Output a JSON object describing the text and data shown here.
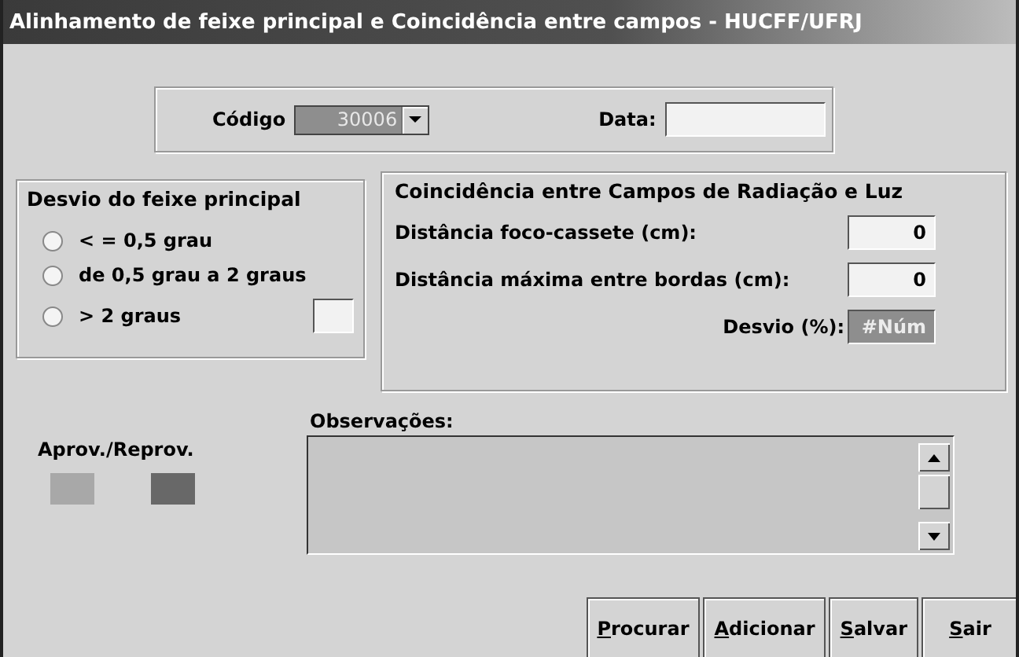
{
  "window": {
    "title": "Alinhamento de feixe principal e Coincidência entre campos - HUCFF/UFRJ"
  },
  "header": {
    "code_label": "Código",
    "code_value": "30006",
    "code_disabled": true,
    "date_label": "Data:"
  },
  "beam_deviation": {
    "title": "Desvio do feixe principal",
    "options": [
      {
        "label": "< = 0,5 grau",
        "selected": false
      },
      {
        "label": "de 0,5 grau a 2 graus",
        "selected": false
      },
      {
        "label": "> 2 graus",
        "selected": false
      }
    ]
  },
  "coincidence": {
    "title": "Coincidência entre Campos de Radiação e Luz",
    "fields": [
      {
        "label": "Distância foco-cassete (cm):",
        "value": "0",
        "disabled": false
      },
      {
        "label": "Distância máxima entre bordas (cm):",
        "value": "0",
        "disabled": false
      },
      {
        "label": "Desvio (%):",
        "value": "#Núm",
        "disabled": true
      }
    ]
  },
  "approval": {
    "label": "Aprov./Reprov.",
    "indicators": [
      {
        "color": "#a8a8a8"
      },
      {
        "color": "#686868"
      }
    ]
  },
  "notes": {
    "label": "Observações:"
  },
  "buttons": [
    "Procurar",
    "Adicionar",
    "Salvar",
    "Sair"
  ]
}
